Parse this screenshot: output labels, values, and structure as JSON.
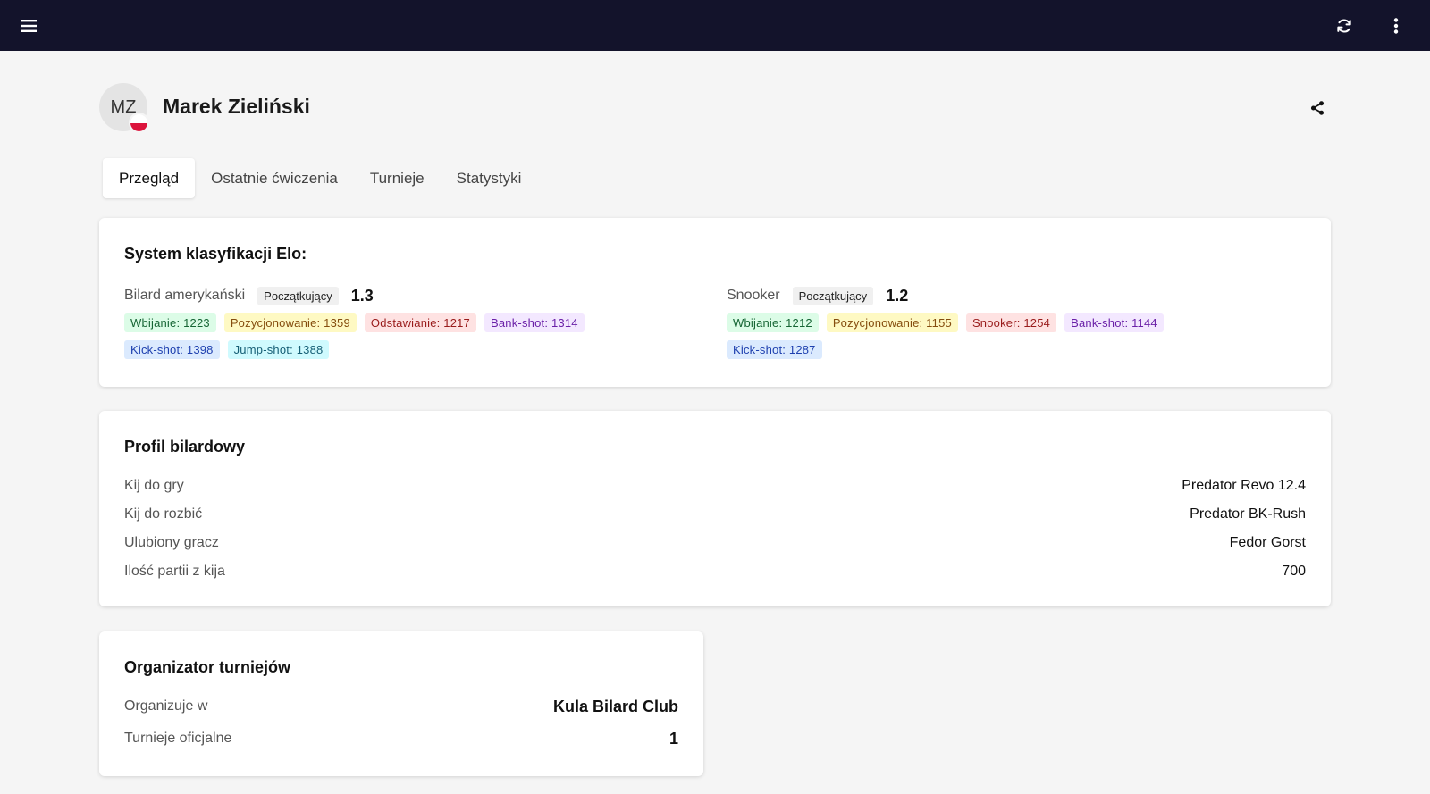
{
  "header": {
    "icons": {
      "menu": "hamburger-menu-icon",
      "refresh": "refresh-icon",
      "more": "more-vertical-icon"
    },
    "background": "#13132b"
  },
  "profile": {
    "initials": "MZ",
    "name": "Marek Zieliński",
    "flag_colors": [
      "#ffffff",
      "#dc143c"
    ]
  },
  "tabs": [
    {
      "label": "Przegląd",
      "active": true
    },
    {
      "label": "Ostatnie ćwiczenia",
      "active": false
    },
    {
      "label": "Turnieje",
      "active": false
    },
    {
      "label": "Statystyki",
      "active": false
    }
  ],
  "elo": {
    "title": "System klasyfikacji Elo:",
    "disciplines": [
      {
        "name": "Bilard amerykański",
        "level": "Początkujący",
        "score": "1.3",
        "chips": [
          {
            "label": "Wbijanie: 1223",
            "color": "green"
          },
          {
            "label": "Pozycjonowanie: 1359",
            "color": "yellow"
          },
          {
            "label": "Odstawianie: 1217",
            "color": "red"
          },
          {
            "label": "Bank-shot: 1314",
            "color": "purple"
          },
          {
            "label": "Kick-shot: 1398",
            "color": "blue"
          },
          {
            "label": "Jump-shot: 1388",
            "color": "cyan"
          }
        ]
      },
      {
        "name": "Snooker",
        "level": "Początkujący",
        "score": "1.2",
        "chips": [
          {
            "label": "Wbijanie: 1212",
            "color": "green"
          },
          {
            "label": "Pozycjonowanie: 1155",
            "color": "yellow"
          },
          {
            "label": "Snooker: 1254",
            "color": "red"
          },
          {
            "label": "Bank-shot: 1144",
            "color": "purple"
          },
          {
            "label": "Kick-shot: 1287",
            "color": "blue"
          }
        ]
      }
    ]
  },
  "billiard_profile": {
    "title": "Profil bilardowy",
    "rows": [
      {
        "label": "Kij do gry",
        "value": "Predator Revo 12.4"
      },
      {
        "label": "Kij do rozbić",
        "value": "Predator BK-Rush"
      },
      {
        "label": "Ulubiony gracz",
        "value": "Fedor Gorst"
      },
      {
        "label": "Ilość partii z kija",
        "value": "700"
      }
    ]
  },
  "organizer": {
    "title": "Organizator turniejów",
    "rows": [
      {
        "label": "Organizuje w",
        "value": "Kula Bilard Club"
      },
      {
        "label": "Turnieje oficjalne",
        "value": "1"
      }
    ]
  }
}
